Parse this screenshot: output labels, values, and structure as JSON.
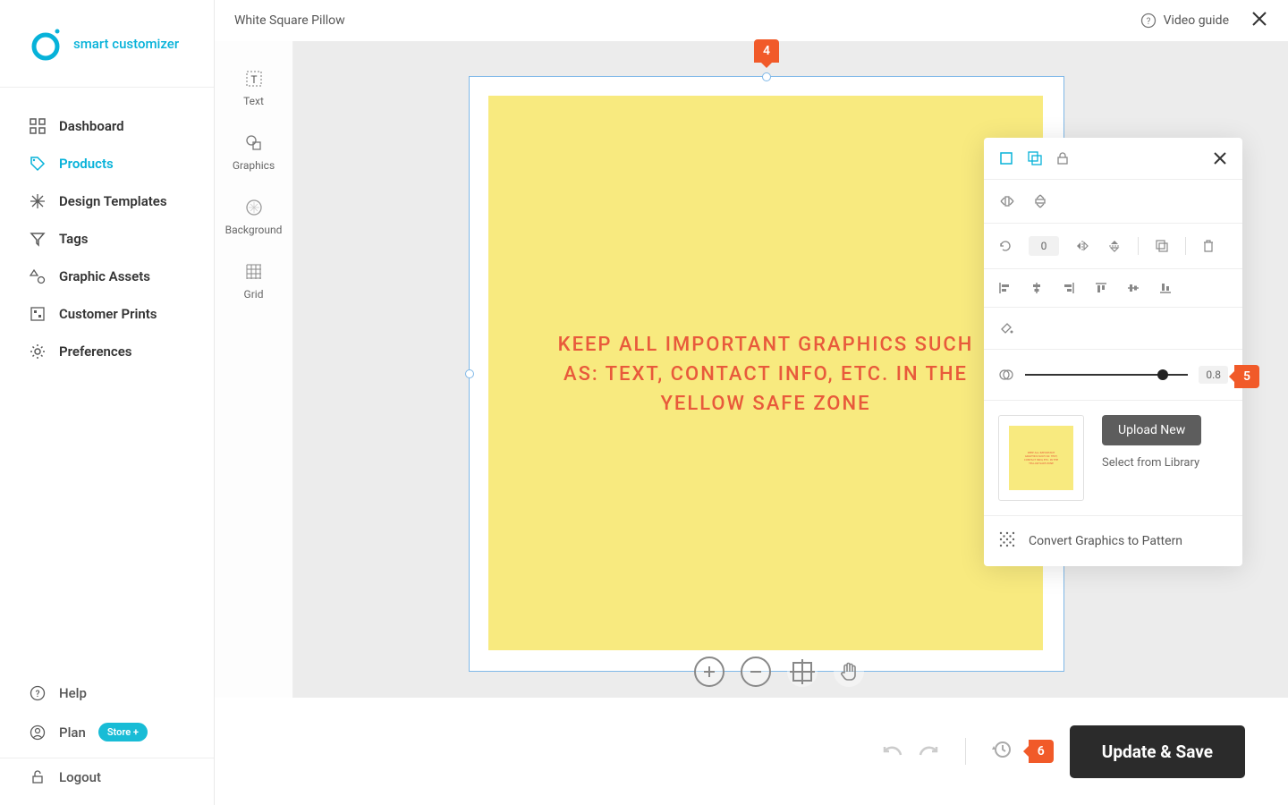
{
  "brand": {
    "name": "smart customizer"
  },
  "sidebar": {
    "items": [
      {
        "label": "Dashboard"
      },
      {
        "label": "Products"
      },
      {
        "label": "Design Templates"
      },
      {
        "label": "Tags"
      },
      {
        "label": "Graphic Assets"
      },
      {
        "label": "Customer Prints"
      },
      {
        "label": "Preferences"
      }
    ],
    "help": "Help",
    "plan": "Plan",
    "plan_badge": "Store +",
    "logout": "Logout"
  },
  "topbar": {
    "title": "White Square Pillow",
    "video_guide": "Video guide"
  },
  "tools": [
    {
      "label": "Text"
    },
    {
      "label": "Graphics"
    },
    {
      "label": "Background"
    },
    {
      "label": "Grid"
    }
  ],
  "canvas": {
    "safe_text": "KEEP ALL IMPORTANT GRAPHICS SUCH AS: TEXT, CONTACT INFO, ETC. IN THE YELLOW SAFE ZONE"
  },
  "props": {
    "rotation": "0",
    "opacity": "0.8",
    "upload": "Upload New",
    "select_lib": "Select from Library",
    "convert": "Convert Graphics to Pattern"
  },
  "annotations": {
    "a4": "4",
    "a5": "5",
    "a6": "6"
  },
  "bottom": {
    "update": "Update & Save"
  }
}
